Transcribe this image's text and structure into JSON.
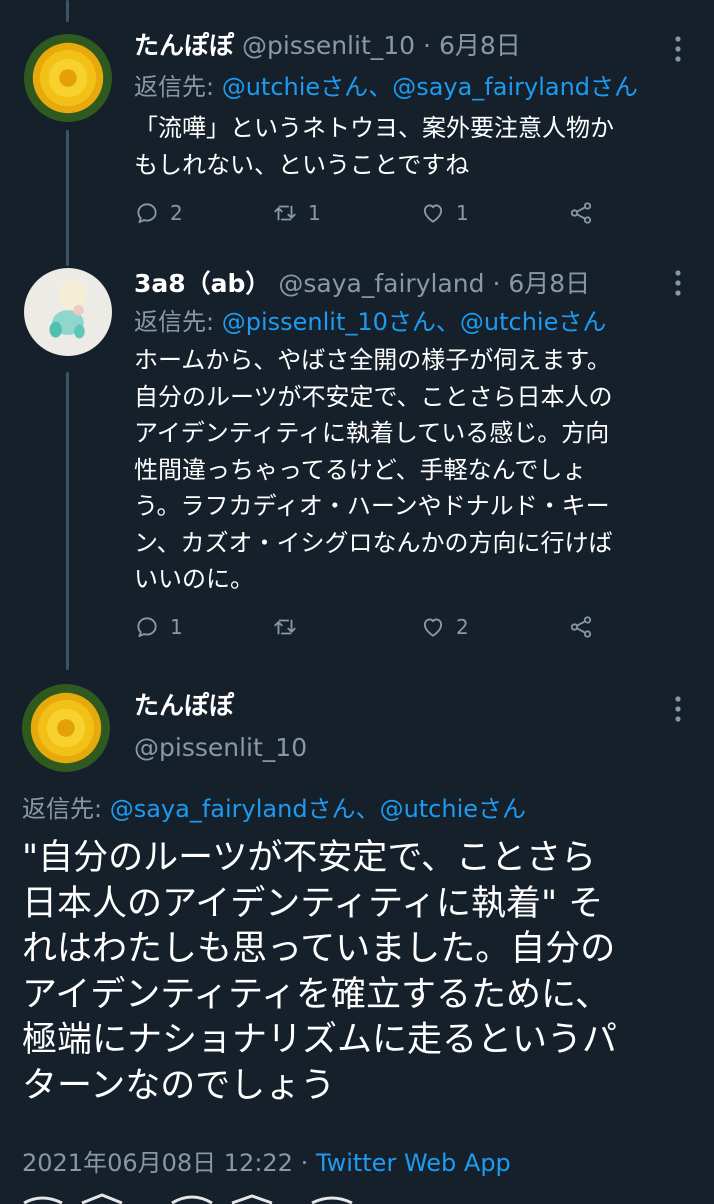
{
  "tweets": [
    {
      "name": "たんぽぽ",
      "handle": "@pissenlit_10",
      "separator": "·",
      "date": "6月8日",
      "reply_prefix": "返信先: ",
      "mentions": [
        "@utchieさん",
        "@saya_fairylandさん"
      ],
      "mention_sep": "、",
      "lines": [
        "「流嘩」というネトウヨ、案外要注意人物か",
        "もしれない、ということですね"
      ],
      "replies": "2",
      "retweets": "1",
      "likes": "1"
    },
    {
      "name": "3a8（ab）",
      "handle": "@saya_fairyland",
      "separator": "·",
      "date": "6月8日",
      "reply_prefix": "返信先: ",
      "mentions": [
        "@pissenlit_10さん",
        "@utchieさん"
      ],
      "mention_sep": "、",
      "lines": [
        "ホームから、やばさ全開の様子が伺えます。",
        "自分のルーツが不安定で、ことさら日本人の",
        "アイデンティティに執着している感じ。方向",
        "性間違っちゃってるけど、手軽なんでしょ",
        "う。ラフカディオ・ハーンやドナルド・キー",
        "ン、カズオ・イシグロなんかの方向に行けば",
        "いいのに。"
      ],
      "replies": "1",
      "retweets": "",
      "likes": "2"
    }
  ],
  "main": {
    "name": "たんぽぽ",
    "handle": "@pissenlit_10",
    "reply_prefix": "返信先: ",
    "mentions": [
      "@saya_fairylandさん",
      "@utchieさん"
    ],
    "mention_sep": "、",
    "lines": [
      "\"自分のルーツが不安定で、ことさら",
      "日本人のアイデンティティに執着\" そ",
      "れはわたしも思っていました。自分の",
      "アイデンティティを確立するために、",
      "極端にナショナリズムに走るというパ",
      "ターンなのでしょう"
    ],
    "timestamp": "2021年06月08日 12:22",
    "separator": "·",
    "source": "Twitter Web App"
  },
  "icons": [
    "reply-icon",
    "retweet-icon",
    "like-icon",
    "share-icon",
    "more-icon"
  ],
  "colors": {
    "background": "#15202b",
    "accent": "#1d9bf0",
    "secondary": "#8899a6"
  }
}
